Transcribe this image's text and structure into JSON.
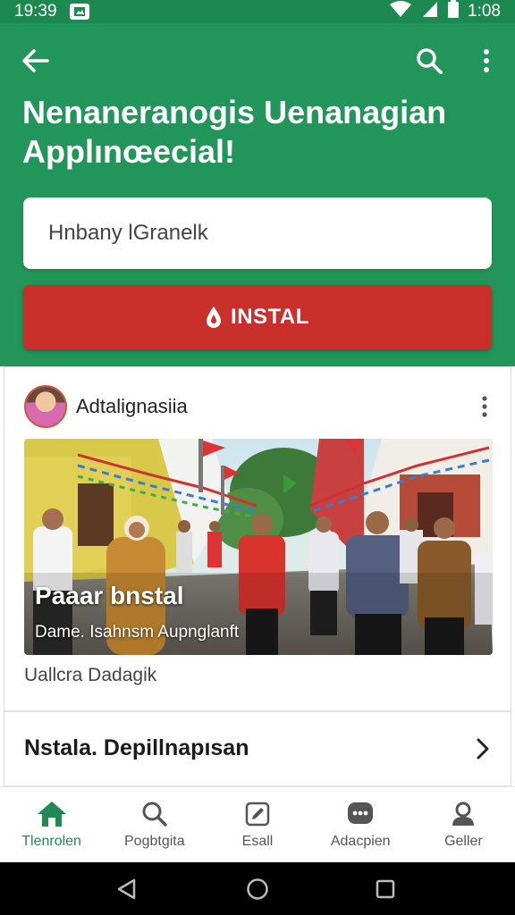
{
  "status_bar": {
    "time": "19:39",
    "clock_right": "1:08"
  },
  "header": {
    "title_line1": "Nenaneranogis Uenanagian",
    "title_line2": "Applınœecial!",
    "name_field_value": "Hnbany lGranelk",
    "install_label": "INSTAL"
  },
  "post": {
    "author": "Adtalignasiia",
    "image_caption": "Paaar bnstal",
    "image_subcaption": "Dame. Isahnsm Aupnglanft",
    "meta": "Uallcra Dadagik"
  },
  "link_row": {
    "label": "Nstala. Depillnapısan"
  },
  "bottom_nav": {
    "items": [
      {
        "label": "Tlenrolen",
        "icon": "home-icon"
      },
      {
        "label": "Pogbtgita",
        "icon": "search-icon"
      },
      {
        "label": "Esall",
        "icon": "edit-icon"
      },
      {
        "label": "Adacpien",
        "icon": "chat-icon"
      },
      {
        "label": "Geller",
        "icon": "profile-icon"
      }
    ]
  },
  "colors": {
    "header": "#22955a",
    "status": "#1c8a50",
    "install": "#c9302c",
    "nav_active": "#1f8a55"
  }
}
